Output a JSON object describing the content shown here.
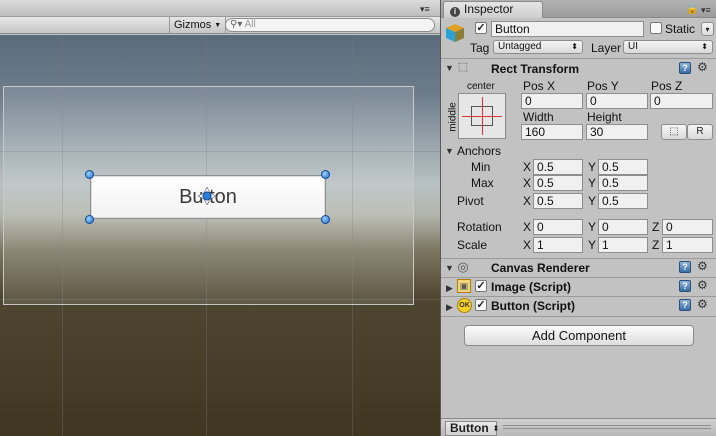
{
  "scene": {
    "gizmos_label": "Gizmos",
    "search_placeholder": "All",
    "button_text": "Button"
  },
  "inspector": {
    "tab_title": "Inspector",
    "object_name": "Button",
    "active": true,
    "static_label": "Static",
    "static_checked": false,
    "tag_label": "Tag",
    "tag_value": "Untagged",
    "layer_label": "Layer",
    "layer_value": "UI",
    "rect_transform": {
      "title": "Rect Transform",
      "anchor_h": "center",
      "anchor_v": "middle",
      "posx_label": "Pos X",
      "posy_label": "Pos Y",
      "posz_label": "Pos Z",
      "posx": "0",
      "posy": "0",
      "posz": "0",
      "width_label": "Width",
      "height_label": "Height",
      "width": "160",
      "height": "30",
      "r_button": "R",
      "anchors_label": "Anchors",
      "min_label": "Min",
      "max_label": "Max",
      "min_x": "0.5",
      "min_y": "0.5",
      "max_x": "0.5",
      "max_y": "0.5",
      "pivot_label": "Pivot",
      "pivot_x": "0.5",
      "pivot_y": "0.5",
      "rotation_label": "Rotation",
      "rot_x": "0",
      "rot_y": "0",
      "rot_z": "0",
      "scale_label": "Scale",
      "scale_x": "1",
      "scale_y": "1",
      "scale_z": "1",
      "x": "X",
      "y": "Y",
      "z": "Z"
    },
    "components": [
      {
        "title": "Canvas Renderer"
      },
      {
        "title": "Image (Script)"
      },
      {
        "title": "Button (Script)"
      }
    ],
    "add_component": "Add Component",
    "footer_title": "Button"
  }
}
